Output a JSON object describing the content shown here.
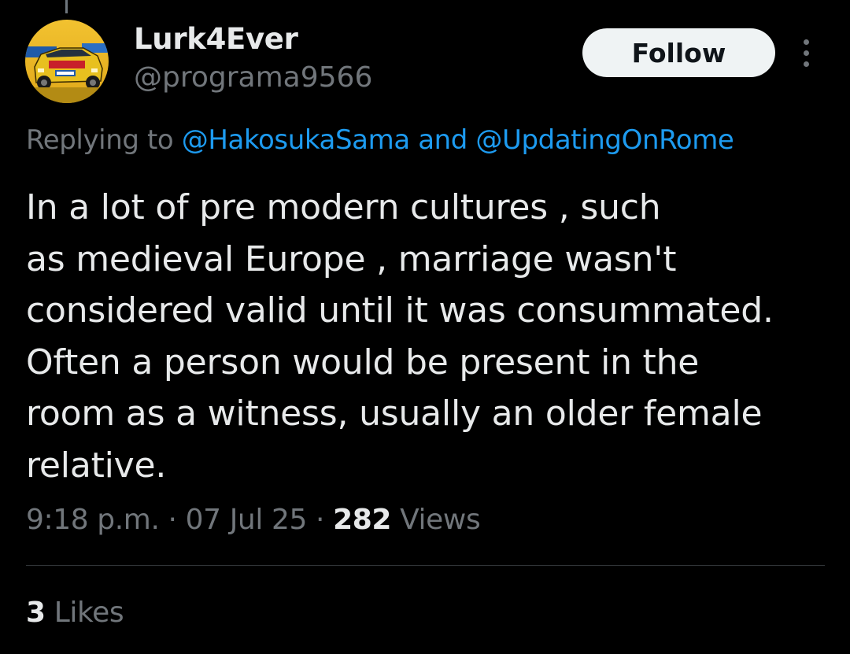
{
  "author": {
    "display_name": "Lurk4Ever",
    "handle": "@programa9566",
    "avatar_icon": "rally-car-avatar"
  },
  "follow_button": {
    "label": "Follow"
  },
  "more_menu": {
    "icon": "more-vertical-icon"
  },
  "reply": {
    "prefix": "Replying to",
    "mention_1": "@HakosukaSama",
    "conjunction": "and",
    "mention_2": "@UpdatingOnRome"
  },
  "tweet": {
    "lines": [
      "In a lot of pre modern cultures , such",
      "as medieval Europe , marriage wasn't",
      "considered valid until it was consummated.",
      "Often a person would be present in the",
      "room as a witness, usually an older female",
      "relative."
    ]
  },
  "meta": {
    "time": "9:18 p.m.",
    "separator": "·",
    "date": "07 Jul 25",
    "views_count": "282",
    "views_label": "Views"
  },
  "engagement": {
    "likes_count": "3",
    "likes_label": "Likes"
  },
  "colors": {
    "background": "#000000",
    "text_primary": "#e7e9ea",
    "text_secondary": "#71767b",
    "link": "#1d9bf0",
    "button_bg": "#eff3f4",
    "divider": "#2f3336"
  }
}
